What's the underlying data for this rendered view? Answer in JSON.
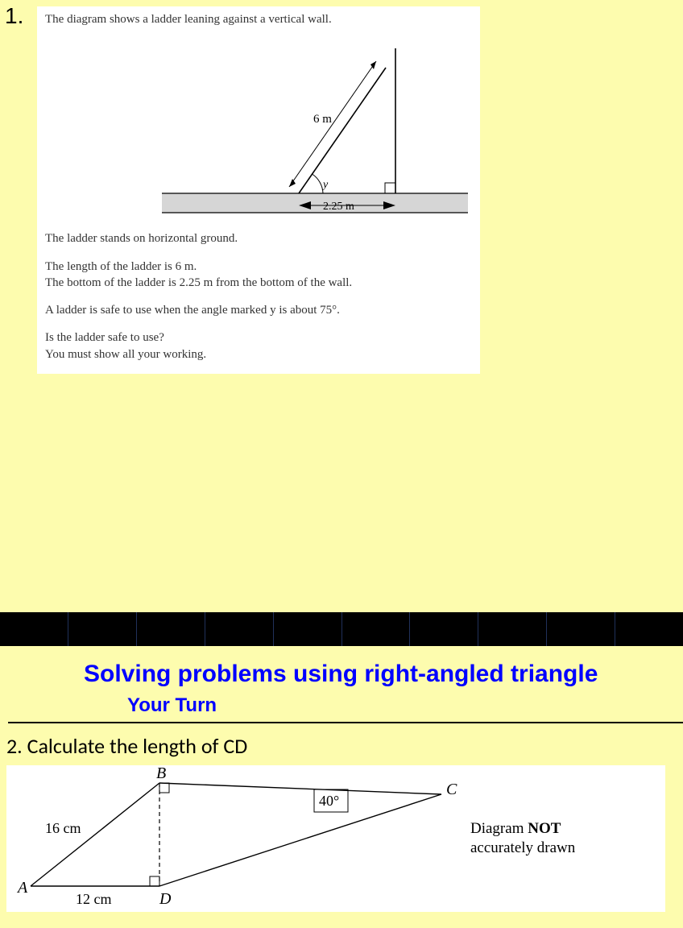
{
  "problem1": {
    "number": "1.",
    "intro": "The diagram shows a ladder leaning against a vertical wall.",
    "diagram": {
      "ladder_label": "6 m",
      "angle_label": "y",
      "base_label": "2.25 m"
    },
    "line_ground": "The ladder stands on horizontal ground.",
    "line_len": "The length of the ladder is 6 m.",
    "line_base": "The bottom of the ladder is 2.25 m from the bottom of the wall.",
    "line_safe": "A ladder is safe to use when the angle marked y is about 75°.",
    "line_q": "Is the ladder safe to use?",
    "line_show": "You must show all your working."
  },
  "slide": {
    "title": "Solving problems using right-angled triangle",
    "subtitle": "Your Turn"
  },
  "problem2": {
    "line": "2.   Calculate the length of CD",
    "diagram": {
      "B": "B",
      "C": "C",
      "A": "A",
      "D": "D",
      "ab_label": "16 cm",
      "ad_label": "12 cm",
      "angle_label": "40°"
    },
    "note1": "Diagram NOT",
    "note2": "accurately drawn"
  }
}
